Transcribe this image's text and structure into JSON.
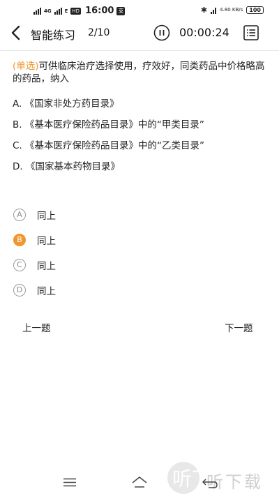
{
  "status_bar": {
    "network_tag": "4G",
    "network_tag2": "E",
    "hd": "HD",
    "time": "16:00",
    "app_badge": "支",
    "speed": "4.80 KB/s",
    "battery": "100"
  },
  "nav": {
    "title": "智能练习",
    "progress": "2/10",
    "timer": "00:00:24"
  },
  "question": {
    "type": "(单选)",
    "text": "可供临床治疗选择使用，疗效好，同类药品中价格略高的药品，纳入",
    "options": [
      "A. 《国家非处方药目录》",
      "B. 《基本医疗保险药品目录》中的“甲类目录”",
      "C. 《基本医疗保险药品目录》中的“乙类目录”",
      "D. 《国家基本药物目录》"
    ]
  },
  "answers": [
    {
      "letter": "A",
      "label": "同上",
      "selected": false
    },
    {
      "letter": "B",
      "label": "同上",
      "selected": true
    },
    {
      "letter": "C",
      "label": "同上",
      "selected": false
    },
    {
      "letter": "D",
      "label": "同上",
      "selected": false
    }
  ],
  "footer": {
    "prev_label": "上一题",
    "next_label": "下一题"
  },
  "watermark": {
    "text": "听下载"
  },
  "colors": {
    "accent": "#f0962e",
    "text": "#222222",
    "divider": "#e6e6e6"
  },
  "icons": [
    "back-icon",
    "pause-icon",
    "answer-card-icon",
    "menu-icon",
    "home-icon",
    "system-back-icon"
  ]
}
